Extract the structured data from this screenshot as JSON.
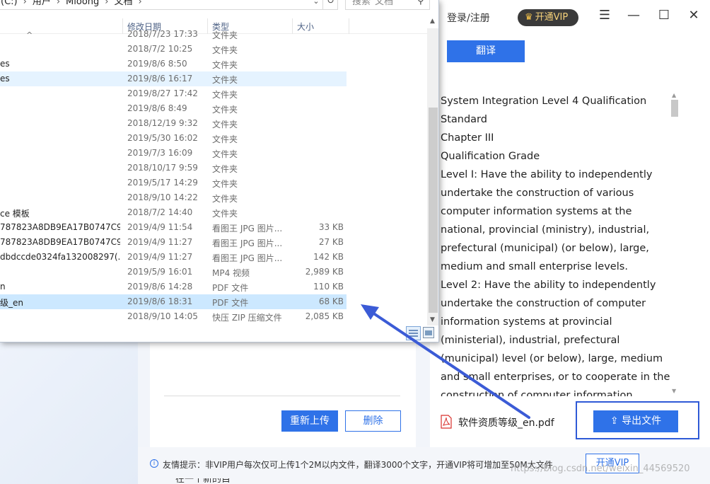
{
  "explorer": {
    "breadcrumb": [
      "(C:)",
      "用户",
      "Mloong",
      "文档"
    ],
    "search_placeholder": "搜索\"文档\"",
    "columns": {
      "date": "修改日期",
      "type": "类型",
      "size": "大小"
    },
    "rows": [
      {
        "name": "",
        "date": "2018/7/23 17:33",
        "type": "文件夹",
        "size": ""
      },
      {
        "name": "",
        "date": "2018/7/2 10:25",
        "type": "文件夹",
        "size": ""
      },
      {
        "name": "es",
        "date": "2019/8/6 8:50",
        "type": "文件夹",
        "size": ""
      },
      {
        "name": "es",
        "date": "2019/8/6 16:17",
        "type": "文件夹",
        "size": ""
      },
      {
        "name": "",
        "date": "2019/8/27 17:42",
        "type": "文件夹",
        "size": ""
      },
      {
        "name": "",
        "date": "2019/8/6 8:49",
        "type": "文件夹",
        "size": ""
      },
      {
        "name": "",
        "date": "2018/12/19 9:32",
        "type": "文件夹",
        "size": ""
      },
      {
        "name": "",
        "date": "2019/5/30 16:02",
        "type": "文件夹",
        "size": ""
      },
      {
        "name": "",
        "date": "2019/7/3 16:09",
        "type": "文件夹",
        "size": ""
      },
      {
        "name": "",
        "date": "2018/10/17 9:59",
        "type": "文件夹",
        "size": ""
      },
      {
        "name": "",
        "date": "2019/5/17 14:29",
        "type": "文件夹",
        "size": ""
      },
      {
        "name": "",
        "date": "2018/9/10 14:22",
        "type": "文件夹",
        "size": ""
      },
      {
        "name": "ce 模板",
        "date": "2018/7/2 14:40",
        "type": "文件夹",
        "size": ""
      },
      {
        "name": "787823A8DB9EA17B0747C9...",
        "date": "2019/4/9 11:54",
        "type": "看图王 JPG 图片...",
        "size": "33 KB"
      },
      {
        "name": "787823A8DB9EA17B0747C9...",
        "date": "2019/4/9 11:27",
        "type": "看图王 JPG 图片...",
        "size": "27 KB"
      },
      {
        "name": "dbdccde0324fa132008297(...",
        "date": "2019/4/9 11:27",
        "type": "看图王 JPG 图片...",
        "size": "142 KB"
      },
      {
        "name": "",
        "date": "2019/5/9 16:01",
        "type": "MP4 视频",
        "size": "2,989 KB"
      },
      {
        "name": "n",
        "date": "2019/8/6 14:28",
        "type": "PDF 文件",
        "size": "110 KB"
      },
      {
        "name": "级_en",
        "date": "2019/8/6 18:31",
        "type": "PDF 文件",
        "size": "68 KB"
      },
      {
        "name": "",
        "date": "2018/9/10 14:05",
        "type": "快压 ZIP 压缩文件",
        "size": "2,085 KB"
      }
    ]
  },
  "app": {
    "login": "登录/注册",
    "vip_badge": "开通VIP",
    "translate_button": "翻译",
    "translated_text": "System Integration Level 4 Qualification Standard\nChapter III\nQualification Grade\nLevel I: Have the ability to independently undertake the construction of various computer information systems at the national, provincial (ministry), industrial, prefectural (municipal) (or below), large, medium and small enterprise levels.\nLevel 2: Have the ability to independently undertake the construction of computer information systems at provincial (ministerial), industrial, prefectural (municipal) level (or below), large, medium and small enterprises, or to cooperate in the construction of computer information systems at the national level",
    "reupload_button": "重新上传",
    "delete_button": "删除",
    "file_name": "软件资质等级_en.pdf",
    "export_button": "导出文件",
    "tip_icon": "i",
    "tip": "友情提示：非VIP用户每次仅可上传1个2M以内文件，翻译3000个文字，开通VIP将可增加至50M大文件",
    "open_vip_button": "开通VIP",
    "watermark": "https://blog.csdn.net/weixin_44569520",
    "bottom_fragment": "在一个新的目"
  },
  "icons": {
    "menu": "hamburger-icon",
    "minimize": "minimize-icon",
    "maximize": "maximize-icon",
    "close": "close-icon",
    "pdf": "pdf-file-icon",
    "export": "upload-icon",
    "search": "search-icon",
    "refresh": "refresh-icon"
  },
  "colors": {
    "accent": "#2f72e8",
    "selection": "#cce8ff",
    "annotation": "#3b5bd6",
    "pdf_red": "#d9302c"
  }
}
